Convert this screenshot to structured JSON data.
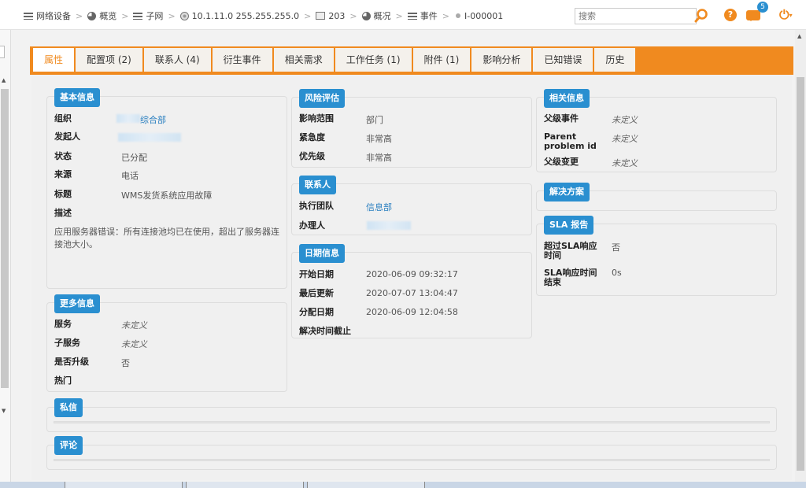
{
  "breadcrumb": [
    {
      "icon": "list-icon",
      "label": "网络设备"
    },
    {
      "icon": "pie-icon",
      "label": "概览"
    },
    {
      "icon": "list-icon",
      "label": "子网"
    },
    {
      "icon": "globe-icon",
      "label": "10.1.11.0 255.255.255.0"
    },
    {
      "icon": "monitor-icon",
      "label": "203"
    },
    {
      "icon": "pie-icon",
      "label": "概况"
    },
    {
      "icon": "list-icon",
      "label": "事件"
    },
    {
      "icon": "dot-icon",
      "label": "I-000001"
    }
  ],
  "header": {
    "search_placeholder": "搜索",
    "help_label": "?",
    "notification_count": "5"
  },
  "tabs": [
    {
      "label": "属性",
      "active": true
    },
    {
      "label": "配置项 (2)"
    },
    {
      "label": "联系人 (4)"
    },
    {
      "label": "衍生事件"
    },
    {
      "label": "相关需求"
    },
    {
      "label": "工作任务 (1)"
    },
    {
      "label": "附件 (1)"
    },
    {
      "label": "影响分析"
    },
    {
      "label": "已知错误"
    },
    {
      "label": "历史"
    }
  ],
  "basic_info": {
    "title": "基本信息",
    "org_label": "组织",
    "org_value": "综合部",
    "requester_label": "发起人",
    "status_label": "状态",
    "status_value": "已分配",
    "source_label": "来源",
    "source_value": "电话",
    "subject_label": "标题",
    "subject_value": "WMS发货系统应用故障",
    "desc_label": "描述",
    "desc_value": "应用服务器错误：所有连接池均已在使用，超出了服务器连接池大小。"
  },
  "more_info": {
    "title": "更多信息",
    "service_label": "服务",
    "service_value": "未定义",
    "subservice_label": "子服务",
    "subservice_value": "未定义",
    "escalated_label": "是否升级",
    "escalated_value": "否",
    "hot_label": "热门"
  },
  "risk": {
    "title": "风险评估",
    "impact_label": "影响范围",
    "impact_value": "部门",
    "urgency_label": "紧急度",
    "urgency_value": "非常高",
    "priority_label": "优先级",
    "priority_value": "非常高"
  },
  "contacts": {
    "title": "联系人",
    "team_label": "执行团队",
    "team_value": "信息部",
    "agent_label": "办理人"
  },
  "dates": {
    "title": "日期信息",
    "start_label": "开始日期",
    "start_value": "2020-06-09 09:32:17",
    "updated_label": "最后更新",
    "updated_value": "2020-07-07 13:04:47",
    "assigned_label": "分配日期",
    "assigned_value": "2020-06-09 12:04:58",
    "deadline_label": "解决时间截止"
  },
  "related": {
    "title": "相关信息",
    "parent_event_label": "父级事件",
    "parent_event_value": "未定义",
    "parent_problem_label": "Parent problem id",
    "parent_problem_value": "未定义",
    "parent_change_label": "父级变更",
    "parent_change_value": "未定义"
  },
  "solution": {
    "title": "解决方案"
  },
  "sla": {
    "title": "SLA 报告",
    "exceeded_label": "超过SLA响应时间",
    "exceeded_value": "否",
    "response_end_label": "SLA响应时间结束",
    "response_end_value": "0s"
  },
  "private_log": {
    "title": "私信"
  },
  "comments": {
    "title": "评论"
  },
  "colors": {
    "accent": "#f08a1f",
    "title_blue": "#2a8fd0",
    "link": "#2a7fc0"
  }
}
